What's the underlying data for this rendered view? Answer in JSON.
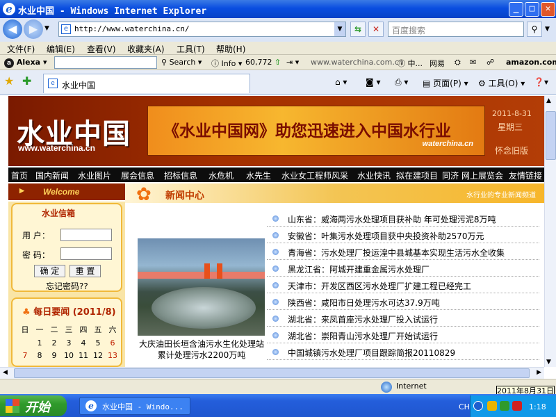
{
  "window": {
    "title": "水业中国 - Windows Internet Explorer"
  },
  "address": {
    "url": "http://www.waterchina.cn/",
    "search_placeholder": "百度搜索"
  },
  "menu": [
    "文件(F)",
    "编辑(E)",
    "查看(V)",
    "收藏夹(A)",
    "工具(T)",
    "帮助(H)"
  ],
  "alexa": {
    "brand": "Alexa",
    "search": "Search",
    "info": "Info",
    "rank": "60,772",
    "site": "www.waterchina.com.cn",
    "china": "中...",
    "netease": "网易",
    "amazon": "amazon.com"
  },
  "tab": {
    "title": "水业中国",
    "page_label": "页面(P)",
    "tools_label": "工具(O)"
  },
  "site": {
    "logo": "水业中国",
    "logo_url": "www.waterchina.cn",
    "slogan": "《水业中国网》助您迅速进入中国水行业",
    "slogan_url": "waterchina.cn",
    "date": "2011-8-31",
    "weekday": "星期三",
    "old_version": "怀念旧版",
    "nav": [
      "首页",
      "国内新闻",
      "水业图片",
      "展会信息",
      "招标信息",
      "水危机",
      "水先生",
      "水业女工程师风采",
      "水业快讯",
      "拟在建项目",
      "同济",
      "网上展览会",
      "友情链接"
    ],
    "welcome": "Welcome",
    "news_center": "新闻中心",
    "news_tagline": "水行业的专业新闻频道",
    "mailbox": {
      "title": "水业信箱",
      "user_label": "用 户：",
      "pass_label": "密 码：",
      "ok": "确 定",
      "reset": "重 置",
      "forgot": "忘记密码??"
    },
    "daily": {
      "title": "每日要闻 (2011/8)",
      "weekdays": [
        "日",
        "一",
        "二",
        "三",
        "四",
        "五",
        "六"
      ],
      "row1": [
        "1",
        "2",
        "3",
        "4",
        "5",
        "6"
      ],
      "row2": [
        "7",
        "8",
        "9",
        "10",
        "11",
        "12",
        "13"
      ]
    },
    "photo_caption_1": "大庆油田长垣含油污水生化处理站",
    "photo_caption_2": "累计处理污水2200万吨",
    "news": [
      "山东省：威海两污水处理项目获补助 年可处理污泥8万吨",
      "安徽省：叶集污水处理项目获中央投资补助2570万元",
      "青海省：污水处理厂投运湟中县城基本实现生活污水全收集",
      "黑龙江省：阿城开建重金属污水处理厂",
      "天津市：开发区西区污水处理厂扩建工程已经完工",
      "陕西省：咸阳市日处理污水可达37.9万吨",
      "湖北省：来凤首座污水处理厂投入试运行",
      "湖北省：崇阳青山污水处理厂开始试运行",
      "中国城镇污水处理厂项目跟踪简报20110829"
    ]
  },
  "status": {
    "zone": "Internet",
    "tooltip": "2011年8月31日"
  },
  "taskbar": {
    "start": "开始",
    "item": "水业中国 - Windo...",
    "lang": "CH",
    "clock": "1:18"
  }
}
